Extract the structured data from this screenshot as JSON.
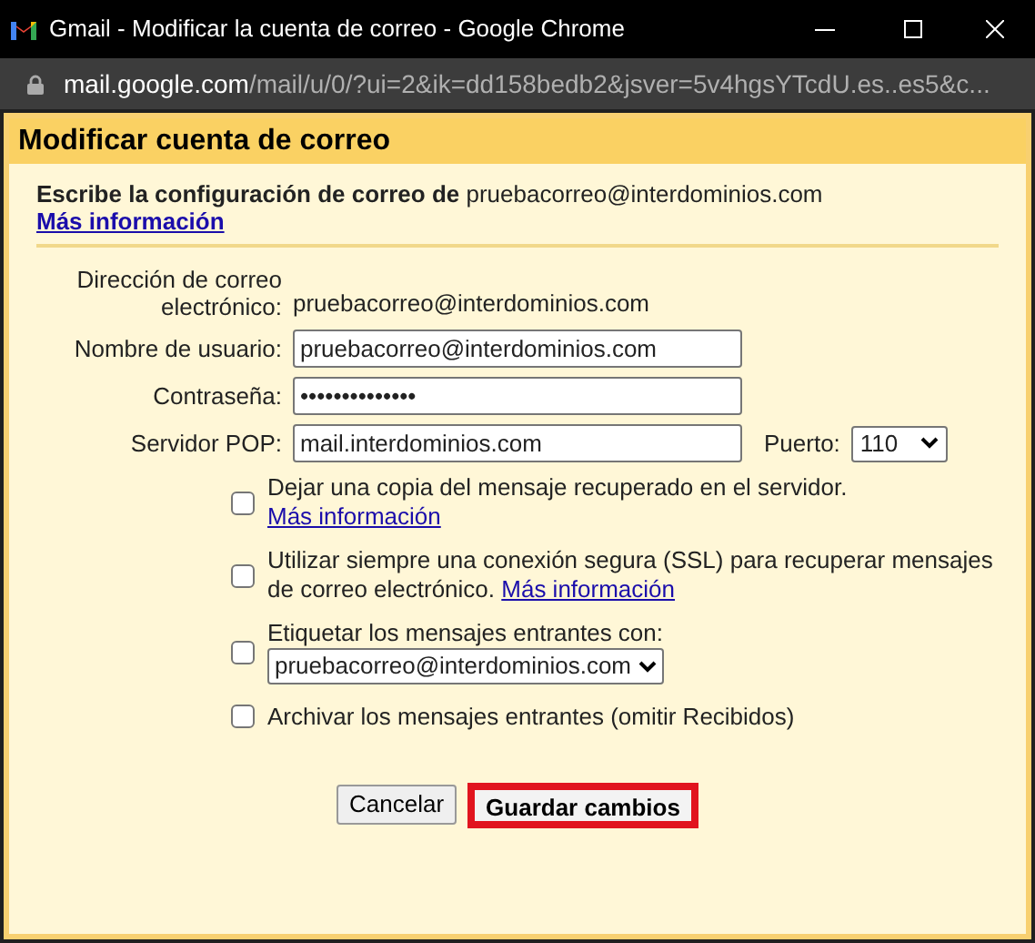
{
  "window": {
    "title": "Gmail - Modificar la cuenta de correo - Google Chrome"
  },
  "address_bar": {
    "host": "mail.google.com",
    "path": "/mail/u/0/?ui=2&ik=dd158bedb2&jsver=5v4hgsYTcdU.es..es5&c..."
  },
  "dialog": {
    "title": "Modificar cuenta de correo",
    "intro": {
      "text": "Escribe la configuración de correo de",
      "email": "pruebacorreo@interdominios.com",
      "link": "Más información"
    },
    "fields": [
      {
        "kind": "static",
        "label": "Dirección de correo electrónico:",
        "value": "pruebacorreo@interdominios.com"
      },
      {
        "kind": "input",
        "label": "Nombre de usuario:",
        "value": "pruebacorreo@interdominios.com"
      },
      {
        "kind": "input",
        "label": "Contraseña:",
        "value": "••••••••••••••"
      },
      {
        "kind": "server",
        "label": "Servidor POP:",
        "value": "mail.interdominios.com",
        "port_label": "Puerto:",
        "port": "110"
      }
    ],
    "options": [
      {
        "kind": "link-below",
        "checked": false,
        "text": "Dejar una copia del mensaje recuperado en el servidor.",
        "link": "Más información"
      },
      {
        "kind": "link-inline",
        "checked": false,
        "text": "Utilizar siempre una conexión segura (SSL) para recuperar mensajes de correo electrónico.",
        "link": "Más información"
      },
      {
        "kind": "select",
        "checked": false,
        "text": "Etiquetar los mensajes entrantes con:",
        "value": "pruebacorreo@interdominios.com"
      },
      {
        "kind": "plain",
        "checked": false,
        "text": "Archivar los mensajes entrantes (omitir Recibidos)"
      }
    ],
    "buttons": [
      {
        "label": "Cancelar",
        "highlighted": false
      },
      {
        "label": "Guardar cambios",
        "highlighted": true
      }
    ]
  }
}
